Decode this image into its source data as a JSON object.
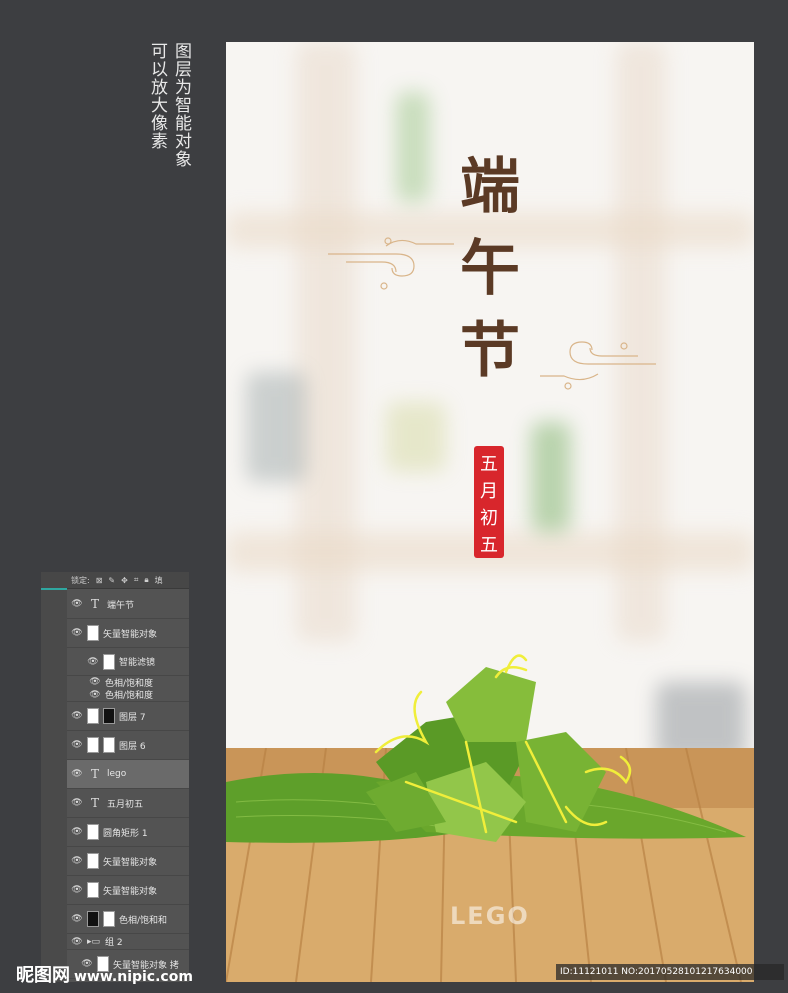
{
  "side_note": {
    "line1": "图层为智能对象",
    "line2": "可以放大像素"
  },
  "poster": {
    "title_chars": [
      "端",
      "午",
      "节"
    ],
    "seal_chars": [
      "五",
      "月",
      "初",
      "五"
    ],
    "logo_text": "LEGO",
    "colors": {
      "title": "#5b3a25",
      "seal": "#d8262c",
      "leaf": "#6aa72c",
      "wood": "#d9ab6c",
      "twine": "#f0ee3a"
    }
  },
  "layers_panel": {
    "lock_label": "锁定:",
    "fill_label": "填",
    "layers": [
      {
        "name": "端午节",
        "kind": "text"
      },
      {
        "name": "矢量智能对象",
        "kind": "smart"
      },
      {
        "name": "智能滤镜",
        "kind": "filter"
      },
      {
        "name": "色相/饱和度",
        "kind": "effect"
      },
      {
        "name": "色相/饱和度",
        "kind": "effect"
      },
      {
        "name": "图层 7",
        "kind": "mask-dark"
      },
      {
        "name": "图层 6",
        "kind": "mask"
      },
      {
        "name": "lego",
        "kind": "text",
        "selected": true
      },
      {
        "name": "五月初五",
        "kind": "text"
      },
      {
        "name": "圆角矩形 1",
        "kind": "smart"
      },
      {
        "name": "矢量智能对象",
        "kind": "smart"
      },
      {
        "name": "矢量智能对象",
        "kind": "smart"
      },
      {
        "name": "色相/饱和和",
        "kind": "adjust"
      },
      {
        "name": "组 2",
        "kind": "group"
      },
      {
        "name": "矢量智能对象 拷",
        "kind": "smart"
      }
    ]
  },
  "watermark_left": {
    "brand": "昵图网",
    "url": "www.nipic.com"
  },
  "watermark_right": "ID:11121011 NO:20170528101217634000"
}
